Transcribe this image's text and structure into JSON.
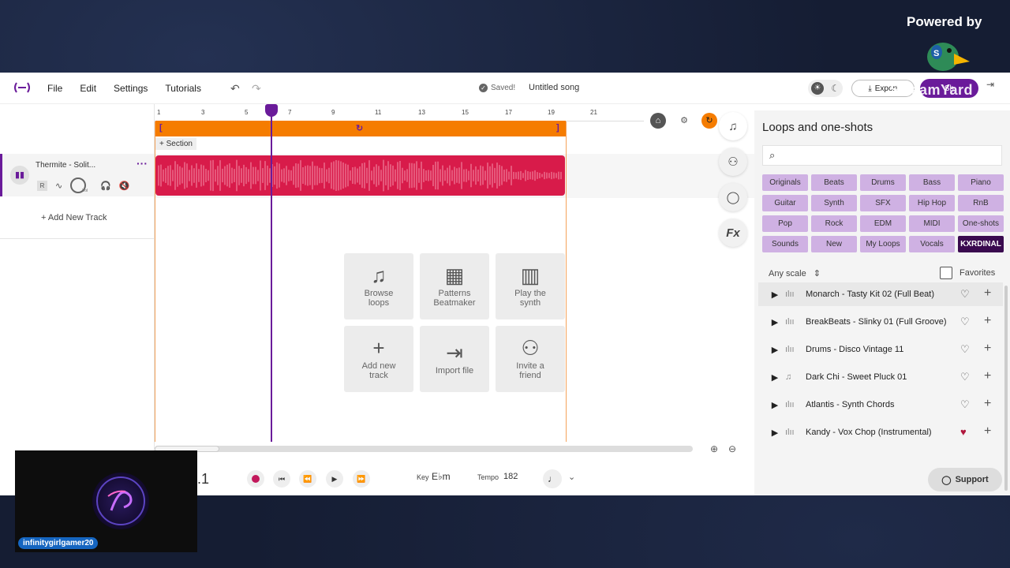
{
  "overlay": {
    "powered_by": "Powered by",
    "streamyard_watermark": "StreamYard",
    "streamer_name": "infinitygirlgamer20"
  },
  "menu": {
    "file": "File",
    "edit": "Edit",
    "settings": "Settings",
    "tutorials": "Tutorials"
  },
  "header": {
    "saved": "Saved!",
    "song_title": "Untitled song",
    "export_label": "Export",
    "share_label": "Sh"
  },
  "track": {
    "name": "Thermite - Solit...",
    "r_label": "R",
    "vol_label": "Vol",
    "add_new_track": "+ Add New Track"
  },
  "ruler": {
    "ticks": [
      "1",
      "3",
      "5",
      "7",
      "9",
      "11",
      "13",
      "15",
      "17",
      "19",
      "21"
    ]
  },
  "timeline": {
    "section_label": "+ Section"
  },
  "actions": {
    "browse_loops": "Browse loops",
    "patterns_beatmaker": "Patterns Beatmaker",
    "play_synth": "Play the synth",
    "add_new_track": "Add new track",
    "import_file": "Import file",
    "invite_friend": "Invite a friend"
  },
  "side_tools": {
    "fx": "Fx"
  },
  "panel": {
    "title": "Loops and one-shots",
    "chips": [
      "Originals",
      "Beats",
      "Drums",
      "Bass",
      "Piano",
      "Guitar",
      "Synth",
      "SFX",
      "Hip Hop",
      "RnB",
      "Pop",
      "Rock",
      "EDM",
      "MIDI",
      "One-shots",
      "Sounds",
      "New",
      "My Loops",
      "Vocals",
      "KXRDINAL"
    ],
    "scale_label": "Any scale",
    "favorites_label": "Favorites",
    "loops": [
      {
        "name": "Monarch - Tasty Kit 02 (Full Beat)",
        "type": "audio",
        "favorite": false
      },
      {
        "name": "BreakBeats - Slinky 01 (Full Groove)",
        "type": "audio",
        "favorite": false
      },
      {
        "name": "Drums - Disco Vintage 11",
        "type": "audio",
        "favorite": false
      },
      {
        "name": "Dark Chi - Sweet Pluck 01",
        "type": "midi",
        "favorite": false
      },
      {
        "name": "Atlantis - Synth Chords",
        "type": "audio",
        "favorite": false
      },
      {
        "name": "Kandy - Vox Chop (Instrumental)",
        "type": "audio",
        "favorite": true
      }
    ]
  },
  "transport": {
    "position": ".1",
    "key_label": "Key",
    "key_value": "E♭m",
    "tempo_label": "Tempo",
    "tempo_value": "182"
  },
  "support": {
    "label": "Support"
  },
  "colors": {
    "accent": "#6a1b9a",
    "loop_bar": "#f57c00",
    "clip": "#d81b4a",
    "chip": "#cfb1e3"
  }
}
